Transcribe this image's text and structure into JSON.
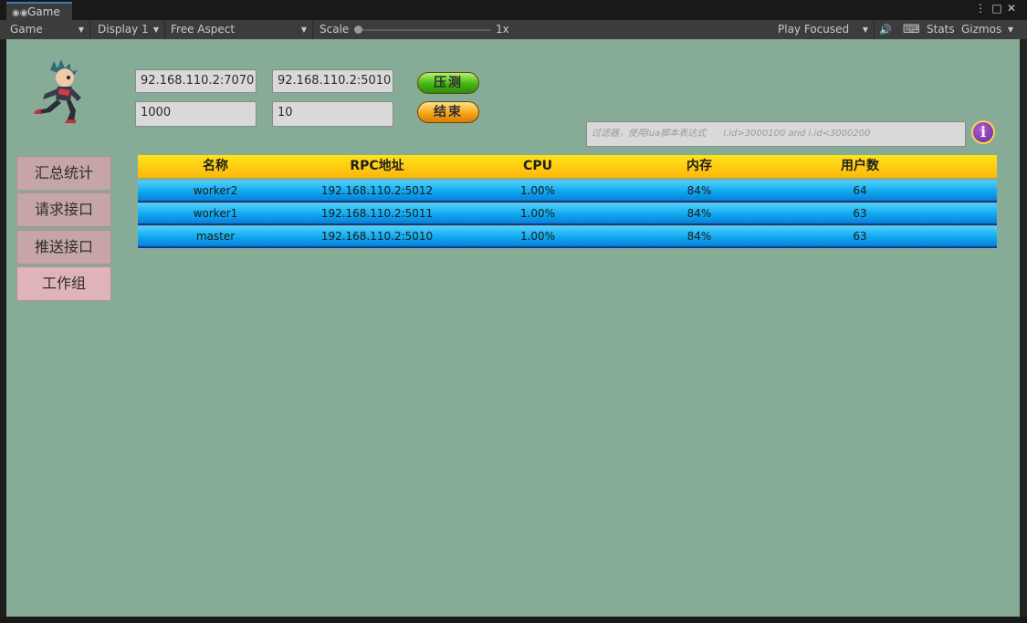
{
  "tab": {
    "icon": "gamepad-icon",
    "title": "Game"
  },
  "toolbar": {
    "view_mode": "Game",
    "display": "Display 1",
    "aspect": "Free Aspect",
    "scale_label": "Scale",
    "scale_value": "1x",
    "play_mode": "Play Focused",
    "stats_label": "Stats",
    "gizmos_label": "Gizmos"
  },
  "inputs": {
    "gateway_address": "92.168.110.2:7070",
    "rpc_address": "92.168.110.2:5010",
    "request_count": "1000",
    "concurrency": "10"
  },
  "buttons": {
    "stress_test": "压测",
    "stop": "结束"
  },
  "filter": {
    "placeholder": "过滤器，使用lua脚本表达式      i.id>3000100 and i.id<3000200"
  },
  "sidebar": {
    "items": [
      {
        "label": "汇总统计"
      },
      {
        "label": "请求接口"
      },
      {
        "label": "推送接口"
      },
      {
        "label": "工作组"
      }
    ],
    "active_index": 3
  },
  "table": {
    "columns": [
      "名称",
      "RPC地址",
      "CPU",
      "内存",
      "用户数"
    ],
    "rows": [
      {
        "name": "worker2",
        "rpc": "192.168.110.2:5012",
        "cpu": "1.00%",
        "memory": "84%",
        "users": "64"
      },
      {
        "name": "worker1",
        "rpc": "192.168.110.2:5011",
        "cpu": "1.00%",
        "memory": "84%",
        "users": "63"
      },
      {
        "name": "master",
        "rpc": "192.168.110.2:5010",
        "cpu": "1.00%",
        "memory": "84%",
        "users": "63"
      }
    ]
  },
  "colors": {
    "game_background": "#86ac98",
    "header_yellow": "#ffe31a",
    "row_blue": "#0fa8ee",
    "active_tab": "#deb4b8",
    "inactive_tab": "#c5a5a5"
  }
}
